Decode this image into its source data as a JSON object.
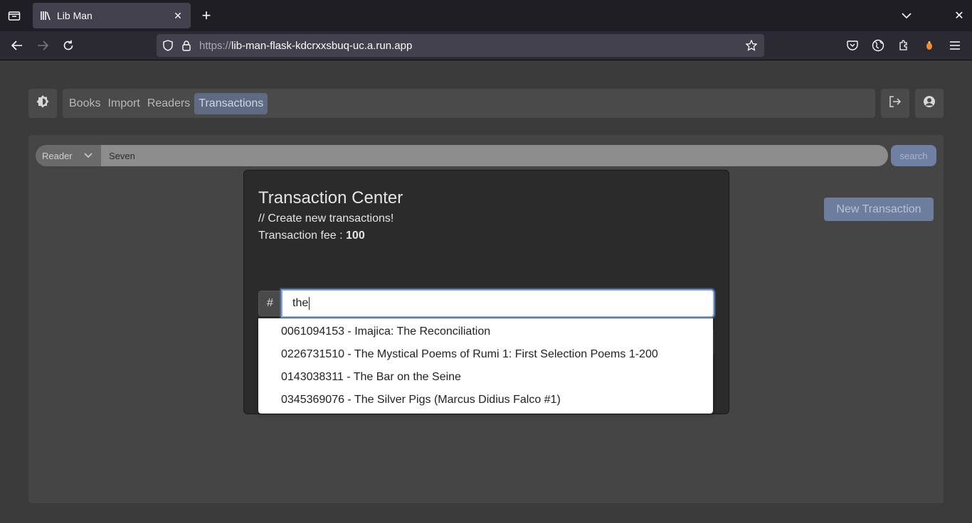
{
  "browser": {
    "tab_title": "Lib Man",
    "url_scheme": "https://",
    "url_host": "lib-man-flask-kdcrxxsbuq-uc.a.run.app"
  },
  "nav": {
    "items": [
      {
        "label": "Books",
        "active": false
      },
      {
        "label": "Import",
        "active": false
      },
      {
        "label": "Readers",
        "active": false
      },
      {
        "label": "Transactions",
        "active": true
      }
    ]
  },
  "search": {
    "filter_value": "Reader",
    "query": "Seven",
    "button_label": "search"
  },
  "new_transaction_label": "New Transaction",
  "modal": {
    "title": "Transaction Center",
    "subtitle": "// Create new transactions!",
    "fee_label": "Transaction fee : ",
    "fee_value": "100",
    "prefix": "#",
    "input_value": "the",
    "suggestions": [
      "0061094153 - Imajica: The Reconciliation",
      "0226731510 - The Mystical Poems of Rumi 1: First Selection Poems 1-200",
      "0143038311 - The Bar on the Seine",
      "0345369076 - The Silver Pigs (Marcus Didius Falco #1)"
    ]
  },
  "icons": {
    "theme_toggle": "theme-toggle-icon",
    "logout": "logout-icon",
    "profile": "user-circle-icon"
  }
}
